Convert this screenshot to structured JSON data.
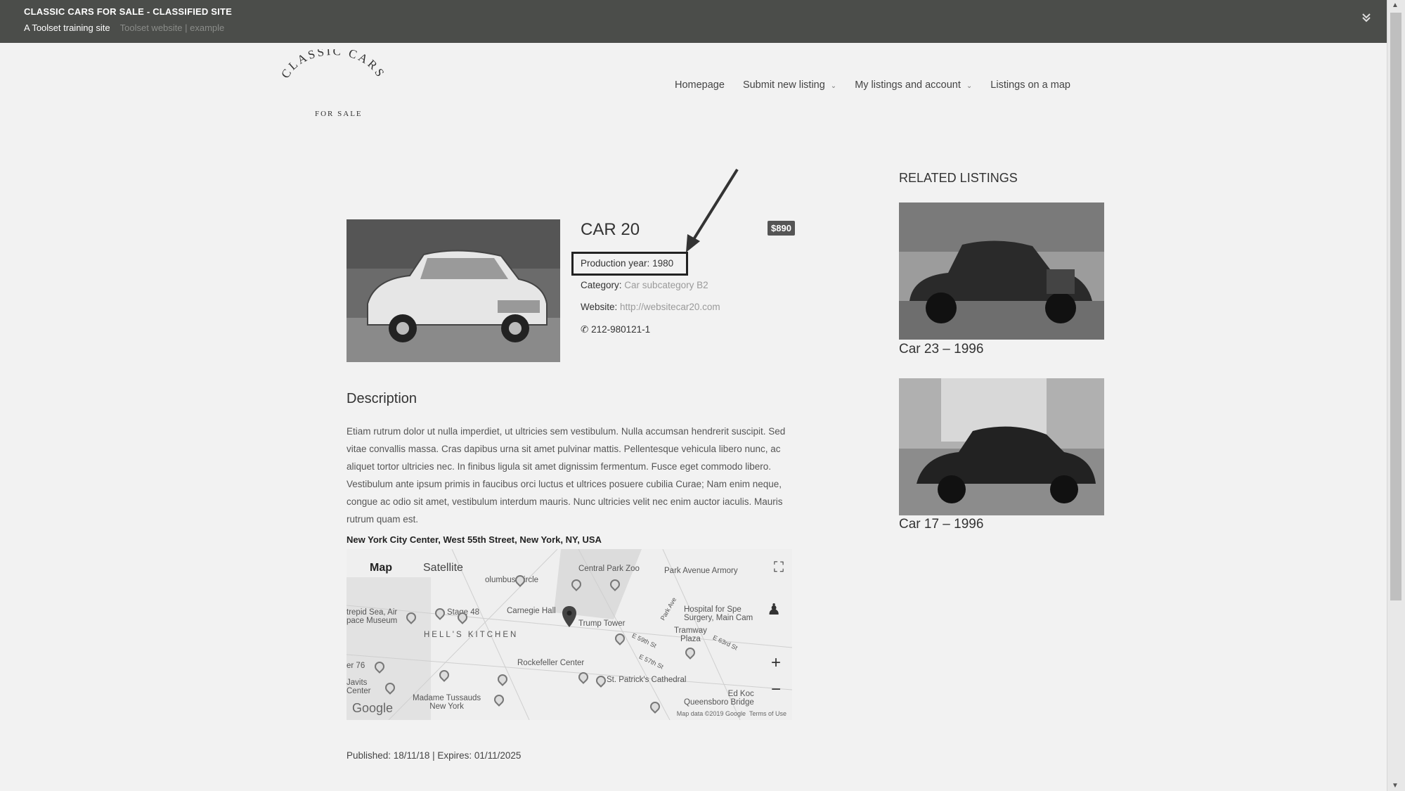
{
  "topbar": {
    "site_title": "CLASSIC CARS FOR SALE - CLASSIFIED SITE",
    "tagline": "A Toolset training site",
    "tagline_faded": "Toolset website | example",
    "collapse_icon": "double-chevron-down-icon"
  },
  "logo": {
    "arc_text": "CLASSIC CARS",
    "sub_text": "FOR SALE"
  },
  "nav": {
    "items": [
      {
        "label": "Homepage"
      },
      {
        "label": "Submit new listing"
      },
      {
        "label": "My listings and account"
      },
      {
        "label": "Listings on a map"
      }
    ]
  },
  "listing": {
    "title": "CAR 20",
    "price": "$890",
    "production_year_label": "Production year:",
    "production_year_value": "1980",
    "category_label": "Category:",
    "category_value": "Car subcategory B2",
    "website_label": "Website:",
    "website_value": "http://websitecar20.com",
    "phone": "212-980121-1",
    "phone_icon": "phone-icon"
  },
  "description": {
    "heading": "Description",
    "text": "Etiam rutrum dolor ut nulla imperdiet, ut ultricies sem vestibulum. Nulla accumsan hendrerit suscipit. Sed vitae convallis massa. Cras dapibus urna sit amet pulvinar mattis. Pellentesque vehicula libero nunc, ac aliquet tortor ultricies nec. In finibus ligula sit amet dignissim fermentum. Fusce eget commodo libero. Vestibulum ante ipsum primis in faucibus orci luctus et ultrices posuere cubilia Curae; Nam enim neque, congue ac odio sit amet, vestibulum interdum mauris. Nunc ultricies velit nec enim auctor iaculis. Mauris rutrum quam est."
  },
  "location": {
    "address": "New York City Center, West 55th Street, New York, NY, USA"
  },
  "map": {
    "tab_map": "Map",
    "tab_satellite": "Satellite",
    "labels": {
      "central_park_zoo": "Central Park Zoo",
      "park_avenue_armory": "Park Avenue Armory",
      "columbus_circle": "olumbus Circle",
      "stage48": "Stage 48",
      "carnegie_hall": "Carnegie Hall",
      "trump_tower": "Trump Tower",
      "intrepid": "trepid Sea, Air\npace Museum",
      "hells_kitchen": "HELL'S KITCHEN",
      "hospital": "Hospital for Spe\nSurgery, Main Cam",
      "tramway": "Tramway\nPlaza",
      "rockefeller": "Rockefeller Center",
      "st_patricks": "St. Patrick's Cathedral",
      "javits": "Javits\nCenter",
      "madame_tussauds": "Madame Tussauds\nNew York",
      "ed_koch": "Ed Koc\nQueensboro Bridge",
      "pier76": "er 76",
      "e59": "E 59th St",
      "e57": "E 57th St",
      "e63": "E 63rd St",
      "park_ave": "Park Ave"
    },
    "google": "Google",
    "map_data": "Map data ©2019 Google",
    "terms": "Terms of Use",
    "fullscreen_icon": "fullscreen-icon",
    "zoom_in": "+",
    "zoom_out": "−",
    "pegman_icon": "pegman-icon"
  },
  "meta": {
    "published": "Published: 18/11/18 | Expires: 01/11/2025"
  },
  "related": {
    "heading": "RELATED LISTINGS",
    "items": [
      {
        "caption": "Car 23 – 1996"
      },
      {
        "caption": "Car 17 – 1996"
      }
    ]
  }
}
